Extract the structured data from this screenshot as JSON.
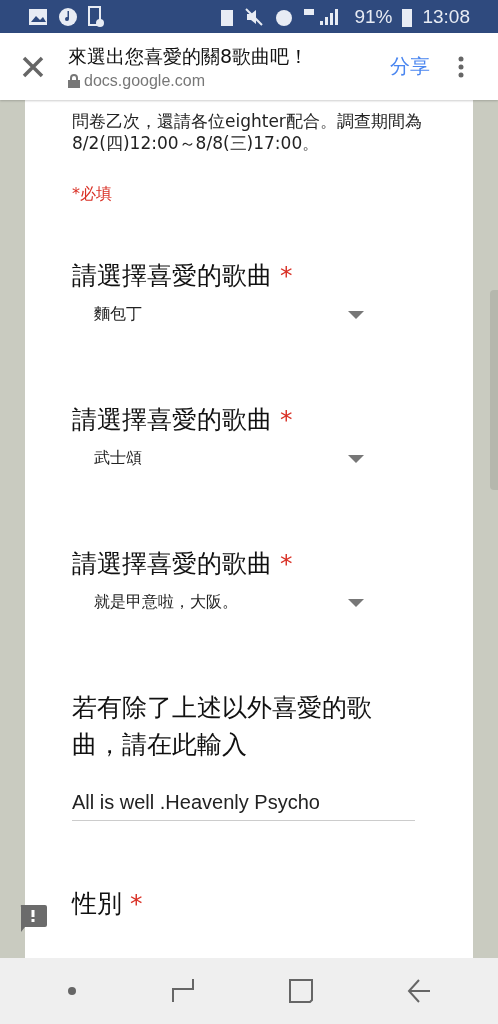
{
  "status_bar": {
    "battery": "91%",
    "time": "13:08"
  },
  "header": {
    "title": "來選出您喜愛的關8歌曲吧！",
    "url": "docs.google.com",
    "share": "分享"
  },
  "description": [
    "問卷乙次，還請各位eighter配合。調查期間為",
    "8/2(四)12:00～8/8(三)17:00。"
  ],
  "required_note": "*必填",
  "questions": [
    {
      "kind": "dropdown",
      "title": "請選擇喜愛的歌曲",
      "required_mark": "*",
      "value": "麵包丁"
    },
    {
      "kind": "dropdown",
      "title": "請選擇喜愛的歌曲",
      "required_mark": "*",
      "value": "武士頌"
    },
    {
      "kind": "dropdown",
      "title": "請選擇喜愛的歌曲",
      "required_mark": "*",
      "value": "就是甲意啦，大阪。"
    },
    {
      "kind": "text",
      "title": "若有除了上述以外喜愛的歌曲，請在此輸入",
      "value": "All is well .Heavenly Psycho"
    },
    {
      "kind": "heading",
      "title": "性別",
      "required_mark": "*"
    }
  ]
}
